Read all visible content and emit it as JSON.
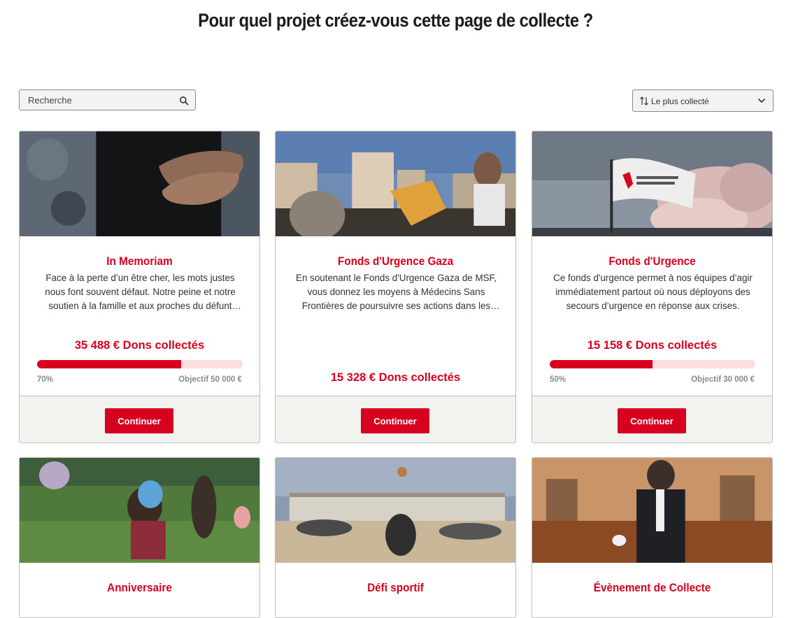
{
  "page": {
    "title": "Pour quel projet créez-vous cette page de collecte ?"
  },
  "search": {
    "placeholder": "Recherche",
    "icon": "search-icon"
  },
  "sort": {
    "selected": "Le plus collecté",
    "icon": "sort-arrows-icon"
  },
  "colors": {
    "brand": "#d8001f",
    "bar_bg": "#fbdde1",
    "footer_bg": "#f2f2ee"
  },
  "cards": [
    {
      "title": "In Memoriam",
      "description": "Face à la perte d’un être cher, les mots justes nous font souvent défaut. Notre peine et notre soutien à la famille et aux proches du défunt peuvent se traduire par un geste de solidarité.",
      "amount": "35 488 € Dons collectés",
      "progress_percent": 70,
      "progress_label": "70%",
      "goal": "Objectif 50 000 €",
      "button": "Continuer"
    },
    {
      "title": "Fonds d'Urgence Gaza",
      "description": "En soutenant le Fonds d'Urgence Gaza de MSF, vous donnez les moyens à Médecins Sans Frontières de poursuivre ses actions dans les zones touchées.",
      "amount": "15 328 € Dons collectés",
      "button": "Continuer"
    },
    {
      "title": "Fonds d'Urgence",
      "description": "Ce fonds d'urgence permet à nos équipes d’agir immédiatement partout où nous déployons des secours d’urgence en réponse aux crises.",
      "amount": "15 158 € Dons collectés",
      "progress_percent": 50,
      "progress_label": "50%",
      "goal": "Objectif 30 000 €",
      "button": "Continuer"
    },
    {
      "title": "Anniversaire"
    },
    {
      "title": "Défi sportif"
    },
    {
      "title": "Évènement de Collecte"
    }
  ]
}
